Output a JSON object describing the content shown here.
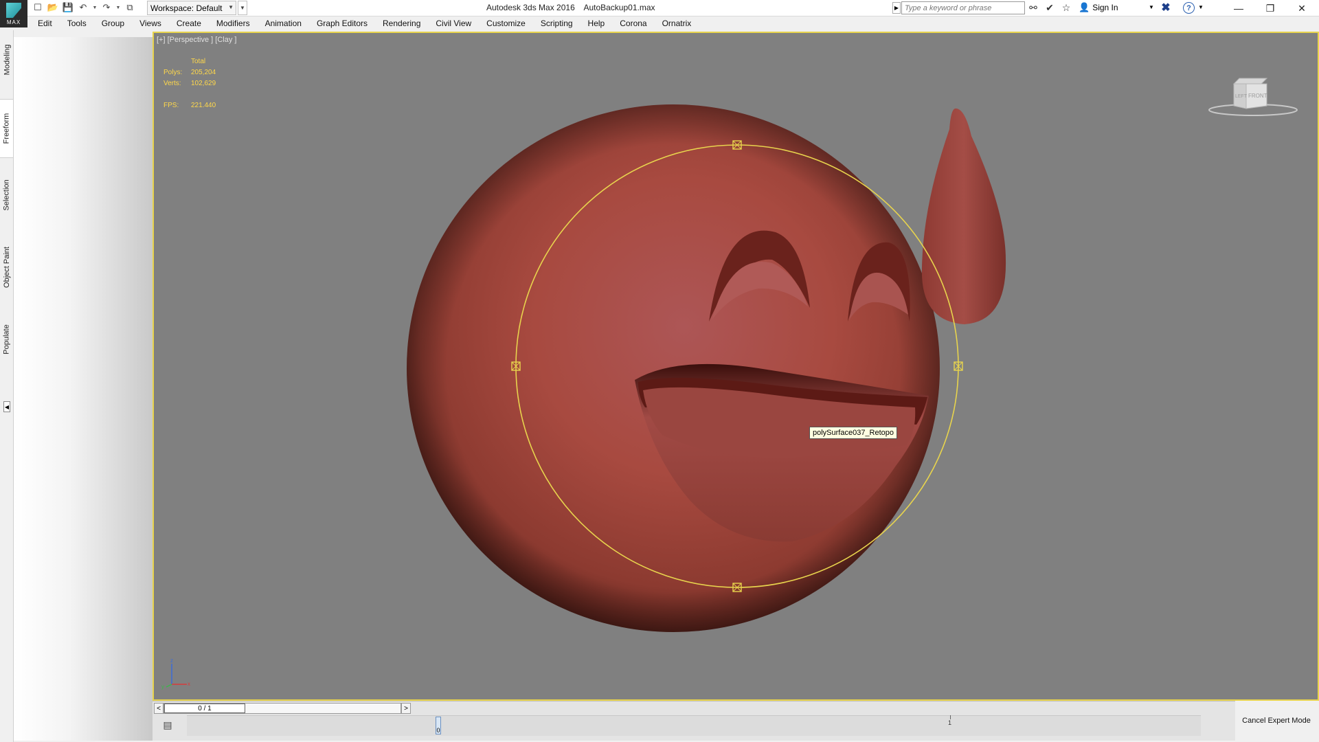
{
  "app": {
    "logo_text": "MAX",
    "window_title": "Autodesk 3ds Max 2016",
    "file_name": "AutoBackup01.max",
    "workspace_label": "Workspace: Default",
    "search_placeholder": "Type a keyword or phrase",
    "sign_in_label": "Sign In"
  },
  "menu": [
    "Edit",
    "Tools",
    "Group",
    "Views",
    "Create",
    "Modifiers",
    "Animation",
    "Graph Editors",
    "Rendering",
    "Civil View",
    "Customize",
    "Scripting",
    "Help",
    "Corona",
    "Ornatrix"
  ],
  "side_tabs": [
    "Modeling",
    "Freeform",
    "Selection",
    "Object Paint",
    "Populate"
  ],
  "active_side_tab": "Freeform",
  "viewport": {
    "label": "[+] [Perspective ] [Clay ]",
    "stats": {
      "total_label": "Total",
      "polys_label": "Polys:",
      "polys_value": "205,204",
      "verts_label": "Verts:",
      "verts_value": "102,629",
      "fps_label": "FPS:",
      "fps_value": "221.440"
    },
    "object_tooltip": "polySurface037_Retopo",
    "viewcube": {
      "left_label": "LEFT",
      "front_label": "FRONT"
    },
    "axis": {
      "x": "x",
      "y": "y",
      "z": "z"
    },
    "colors": {
      "background": "#808080",
      "selection": "#e8d44d",
      "clay": "#b0473c"
    }
  },
  "timeline": {
    "slider_text": "0 / 1",
    "prev": "<",
    "next": ">",
    "frame_start": "0",
    "frame_tick": "1"
  },
  "expert_mode_button": "Cancel Expert Mode"
}
